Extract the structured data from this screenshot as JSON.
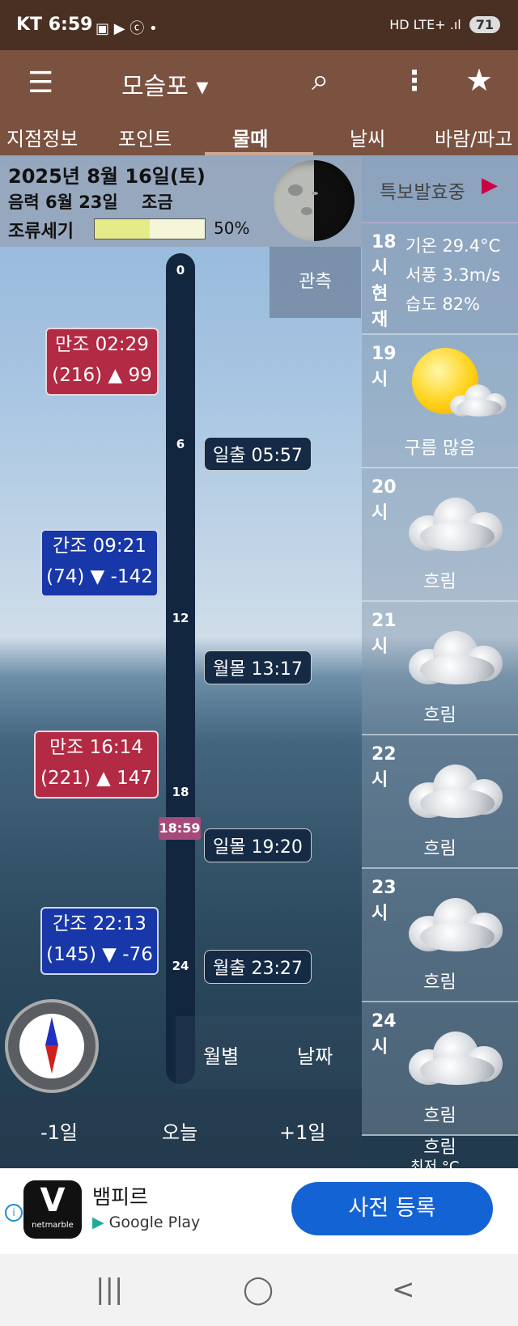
{
  "status_bar": {
    "carrier_time": "KT 6:59",
    "icons": "▣ ▶ ⓒ •",
    "network": "HD LTE+ .ıl",
    "battery": "71"
  },
  "app_bar": {
    "location": "모슬포 ▾"
  },
  "tabs": [
    "지점정보",
    "포인트",
    "물때",
    "날씨",
    "바람/파고"
  ],
  "active_tab": "물때",
  "date_header": {
    "date": "2025년 8월 16일(토)",
    "lunar": "음력 6월 23일",
    "tide_phase": "조금",
    "strength_label": "조류세기",
    "strength_percent": 50,
    "strength_text": "50%"
  },
  "observation_button": "관측",
  "alert": {
    "label": "특보발효중",
    "arrow": "▶"
  },
  "current_weather": {
    "time_label": "18시현재",
    "temp": "기온 29.4°C",
    "wind": "서풍 3.3m/s",
    "humidity": "습도 82%"
  },
  "hourly_forecast": [
    {
      "hour": "19시",
      "condition": "구름 많음",
      "icon": "partly-cloudy-icon"
    },
    {
      "hour": "20시",
      "condition": "흐림",
      "icon": "cloud-icon"
    },
    {
      "hour": "21시",
      "condition": "흐림",
      "icon": "cloud-icon"
    },
    {
      "hour": "22시",
      "condition": "흐림",
      "icon": "cloud-icon"
    },
    {
      "hour": "23시",
      "condition": "흐림",
      "icon": "cloud-icon"
    },
    {
      "hour": "24시",
      "condition": "흐림",
      "icon": "cloud-icon"
    }
  ],
  "bottom_condition": "흐림",
  "partial_text": "최저 °C",
  "time_scale": {
    "ticks": [
      "0",
      "6",
      "12",
      "18",
      "24"
    ],
    "now": "18:59"
  },
  "tides": [
    {
      "type": "만조",
      "line1": "만조 02:29",
      "line2": "(216) ▲ 99"
    },
    {
      "type": "간조",
      "line1": "간조 09:21",
      "line2": "(74) ▼ -142"
    },
    {
      "type": "만조",
      "line1": "만조 16:14",
      "line2": "(221) ▲ 147"
    },
    {
      "type": "간조",
      "line1": "간조 22:13",
      "line2": "(145) ▼ -76"
    }
  ],
  "events": [
    {
      "label": "일출 05:57"
    },
    {
      "label": "월몰 13:17"
    },
    {
      "label": "일몰 19:20"
    },
    {
      "label": "월출 23:27"
    }
  ],
  "bottom_nav": {
    "monthly": "월별",
    "by_date": "날짜",
    "prev": "-1일",
    "today": "오늘",
    "next": "+1일"
  },
  "ad": {
    "app_name": "뱀피르",
    "store": "Google Play",
    "cta": "사전 등록",
    "logo_mark": "V",
    "brand": "netmarble"
  },
  "colors": {
    "app_bar": "#7b5140",
    "status_bar": "#4a2f23",
    "high_tide": "#b22a43",
    "low_tide": "#1837a8",
    "cta": "#1463d4"
  }
}
